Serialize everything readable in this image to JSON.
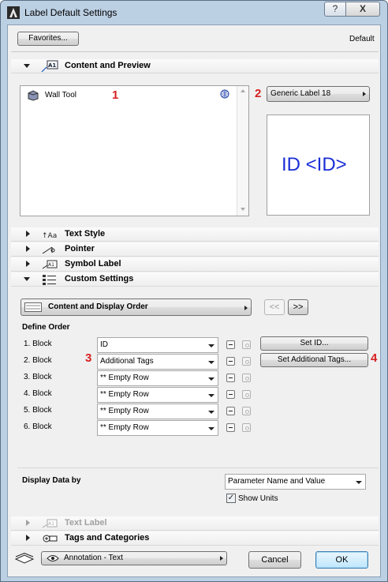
{
  "window": {
    "title": "Label Default Settings",
    "help_label": "?",
    "close_label": "X"
  },
  "top": {
    "favorites_label": "Favorites...",
    "default_label": "Default"
  },
  "sections": {
    "content_preview": "Content and Preview",
    "text_style": "Text Style",
    "pointer": "Pointer",
    "symbol_label": "Symbol Label",
    "custom_settings": "Custom Settings",
    "text_label": "Text Label",
    "tags_categories": "Tags and Categories"
  },
  "content_preview": {
    "tool_item": "Wall Tool",
    "label_type": "Generic Label 18",
    "preview_text": "ID <ID>"
  },
  "annotations": {
    "n1": "1",
    "n2": "2",
    "n3": "3",
    "n4": "4"
  },
  "custom_settings": {
    "content_display_order": "Content and Display Order",
    "prev_label": "<<",
    "next_label": ">>",
    "define_order_label": "Define Order",
    "blocks": [
      {
        "label": "1. Block",
        "value": "ID"
      },
      {
        "label": "2. Block",
        "value": "Additional Tags"
      },
      {
        "label": "3. Block",
        "value": "** Empty Row"
      },
      {
        "label": "4. Block",
        "value": "** Empty Row"
      },
      {
        "label": "5. Block",
        "value": "** Empty Row"
      },
      {
        "label": "6. Block",
        "value": "** Empty Row"
      }
    ],
    "set_id_label": "Set ID...",
    "set_additional_tags_label": "Set Additional Tags...",
    "display_data_by_label": "Display Data by",
    "display_data_value": "Parameter Name and Value",
    "show_units_label": "Show Units",
    "show_units_checked": true
  },
  "footer": {
    "layer_value": "Annotation - Text",
    "cancel_label": "Cancel",
    "ok_label": "OK"
  },
  "colors": {
    "preview_text": "#1a2fd6",
    "annotation_red": "#d62020",
    "title_bg": "#bcd0e4"
  }
}
